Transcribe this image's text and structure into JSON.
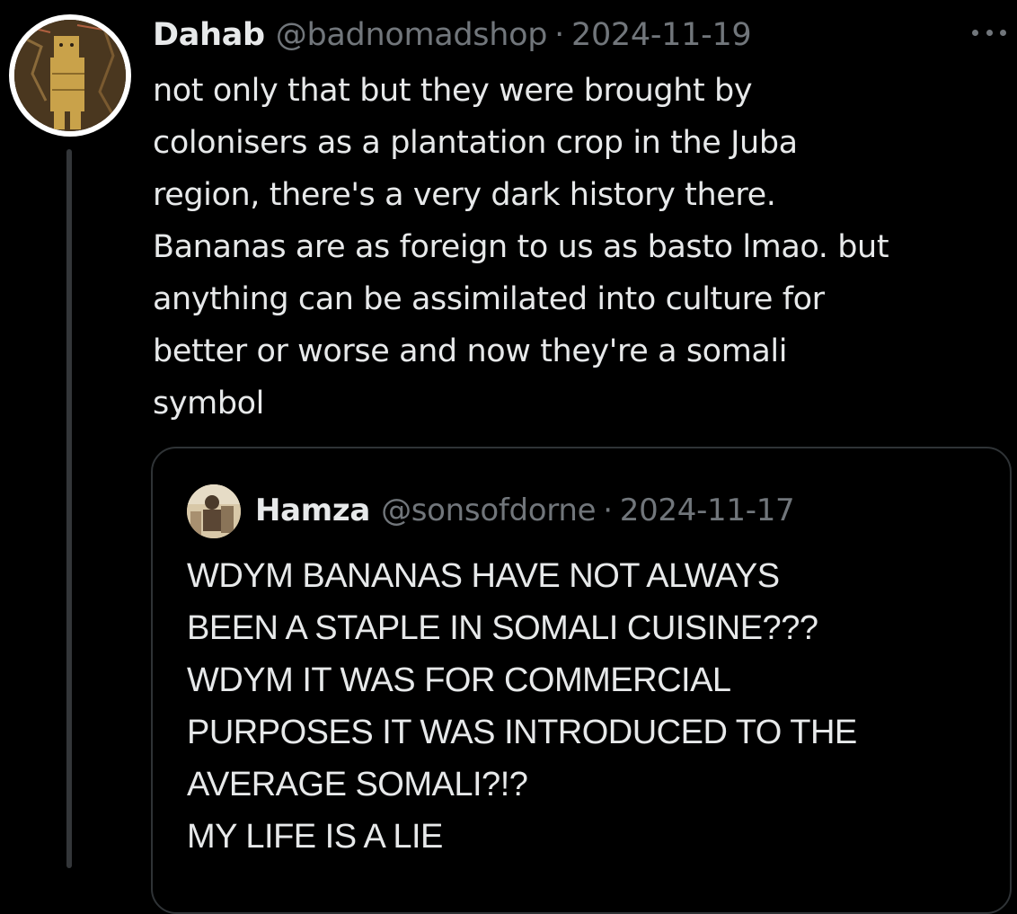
{
  "tweet": {
    "display_name": "Dahab",
    "handle": "@badnomadshop",
    "separator": "·",
    "date": "2024-11-19",
    "avatar_icon": "profile-avatar-icon",
    "text_lines": [
      "not only that but they were brought by",
      "colonisers as a plantation crop in the Juba",
      "region, there's a very dark history there.",
      "Bananas are as foreign to us as basto lmao. but",
      "anything can be assimilated into culture for",
      "better or worse and now they're a somali",
      "symbol"
    ]
  },
  "quote": {
    "display_name": "Hamza",
    "handle": "@sonsofdorne",
    "separator": "·",
    "date": "2024-11-17",
    "avatar_icon": "profile-avatar-icon",
    "text_lines": [
      "WDYM BANANAS HAVE NOT ALWAYS",
      "BEEN A STAPLE IN SOMALI CUISINE???",
      "WDYM IT WAS FOR COMMERCIAL",
      "PURPOSES IT WAS INTRODUCED TO THE",
      "AVERAGE SOMALI?!?",
      "MY LIFE IS A LIE"
    ]
  },
  "icons": {
    "more": "more-options-icon"
  },
  "colors": {
    "background": "#000000",
    "text_primary": "#e7e9ea",
    "text_secondary": "#71767b",
    "border": "#2f3336"
  }
}
